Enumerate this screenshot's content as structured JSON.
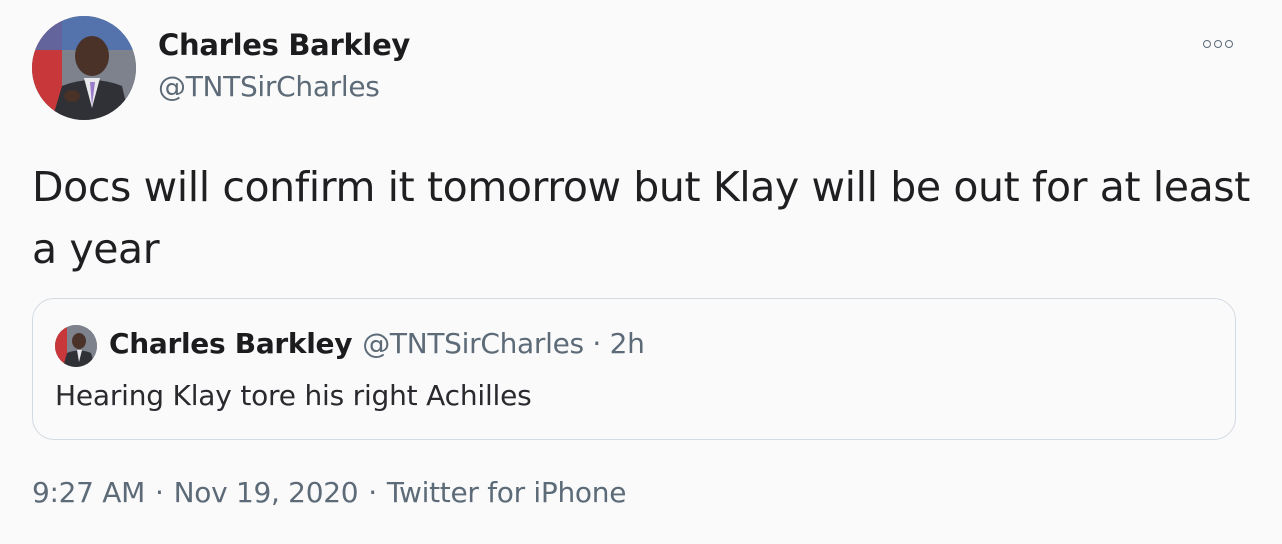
{
  "author": {
    "name": "Charles Barkley",
    "handle": "@TNTSirCharles"
  },
  "tweet": {
    "text": "Docs will confirm it tomorrow but Klay will be out for at least a year"
  },
  "quoted_tweet": {
    "name": "Charles Barkley",
    "handle_time": "@TNTSirCharles · 2h",
    "text": "Hearing Klay tore his right Achilles"
  },
  "meta": {
    "time": "9:27 AM",
    "date": "Nov 19, 2020",
    "source": "Twitter for iPhone",
    "separator": "·"
  },
  "icons": {
    "more": "more-options-icon"
  },
  "colors": {
    "secondary_text": "#5c6b77",
    "border": "#d3dae0",
    "background": "#fafafb"
  }
}
